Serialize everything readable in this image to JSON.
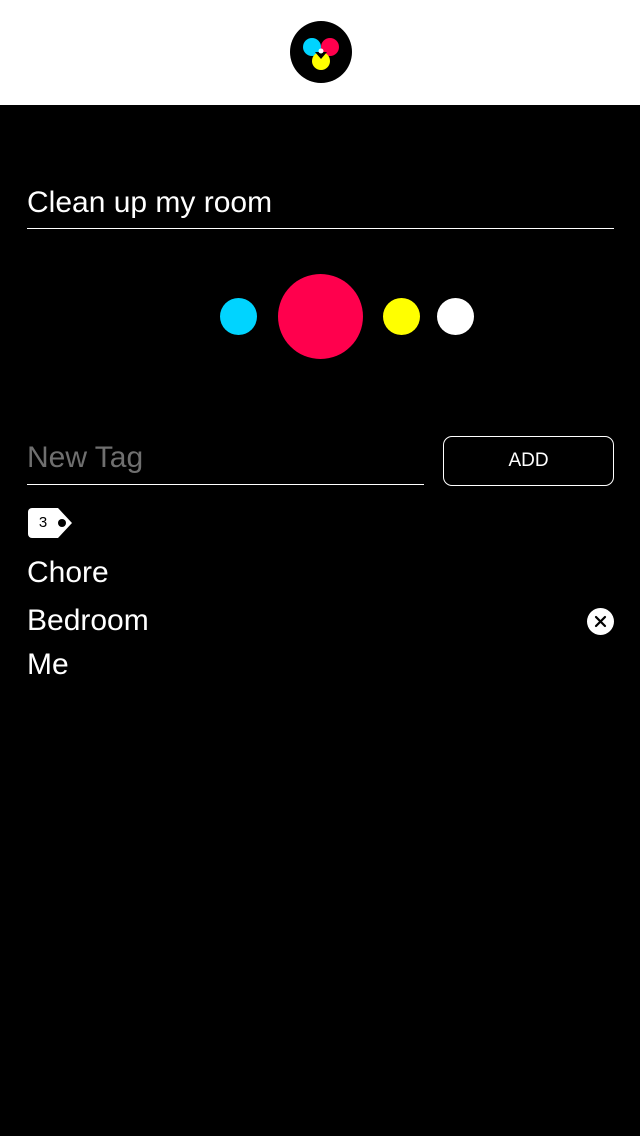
{
  "header": {
    "logo_icon": "cmy-circles-logo-icon"
  },
  "task": {
    "title": "Clean up my room"
  },
  "colors": {
    "swatches": [
      {
        "name": "cyan",
        "hex": "#00d4ff",
        "selected": false
      },
      {
        "name": "magenta",
        "hex": "#ff004d",
        "selected": true
      },
      {
        "name": "yellow",
        "hex": "#ffff00",
        "selected": false
      },
      {
        "name": "white",
        "hex": "#ffffff",
        "selected": false
      }
    ]
  },
  "new_tag": {
    "placeholder": "New Tag",
    "value": "",
    "add_label": "ADD"
  },
  "tags": {
    "count": "3",
    "count_icon": "tag-icon",
    "items": [
      {
        "label": "Chore"
      },
      {
        "label": "Bedroom",
        "remove_icon": "close-icon"
      },
      {
        "label": "Me"
      }
    ]
  }
}
